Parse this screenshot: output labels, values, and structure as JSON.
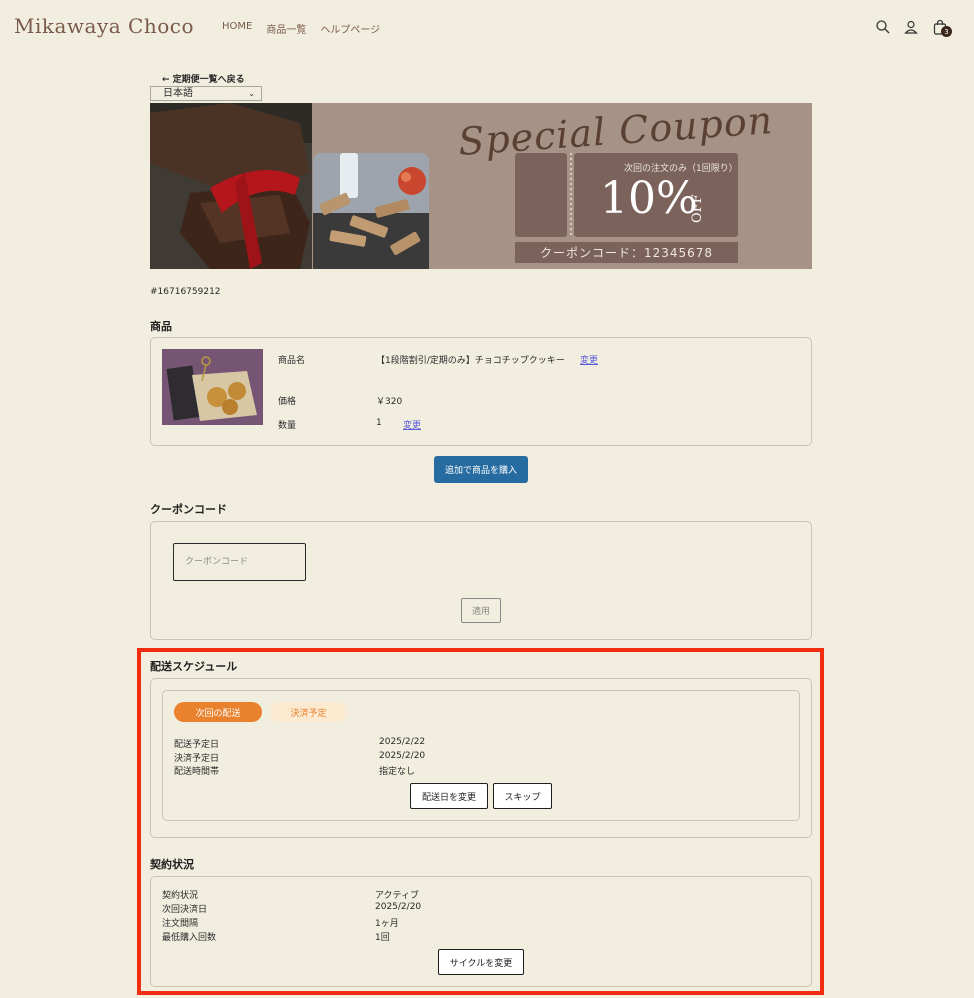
{
  "header": {
    "logo": "Mikawaya Choco",
    "nav": [
      "HOME",
      "商品一覧",
      "ヘルプページ"
    ],
    "cart_count": "3"
  },
  "back_link": "← 定期便一覧へ戻る",
  "language": {
    "selected": "日本語"
  },
  "banner": {
    "title": "Special Coupon",
    "note": "次回の注文のみ（1回限り）",
    "discount": "10%",
    "off": "OFF",
    "code_text": "クーポンコード：12345678"
  },
  "order_id": "#16716759212",
  "product_section": {
    "title": "商品",
    "name_label": "商品名",
    "name_value": "【1段階割引/定期のみ】チョコチップクッキー",
    "change": "変更",
    "price_label": "価格",
    "price_value": "￥320",
    "qty_label": "数量",
    "qty_value": "1",
    "add_button": "追加で商品を購入"
  },
  "coupon_section": {
    "title": "クーポンコード",
    "placeholder": "クーポンコード",
    "apply": "適用"
  },
  "schedule_section": {
    "title": "配送スケジュール",
    "tab_next": "次回の配送",
    "tab_payment": "決済予定",
    "rows": [
      {
        "label": "配送予定日",
        "value": "2025/2/22"
      },
      {
        "label": "決済予定日",
        "value": "2025/2/20"
      },
      {
        "label": "配送時間帯",
        "value": "指定なし"
      }
    ],
    "change_date": "配送日を変更",
    "skip": "スキップ"
  },
  "contract_section": {
    "title": "契約状況",
    "rows": [
      {
        "label": "契約状況",
        "value": "アクティブ"
      },
      {
        "label": "次回決済日",
        "value": "2025/2/20"
      },
      {
        "label": "注文間隔",
        "value": "1ヶ月"
      },
      {
        "label": "最低購入回数",
        "value": "1回"
      }
    ],
    "change_cycle": "サイクルを変更"
  },
  "colors": {
    "background": "#f1eedf",
    "accent_orange": "#e9812d",
    "primary_blue": "#276ca0",
    "highlight_red": "#f22d0f"
  }
}
